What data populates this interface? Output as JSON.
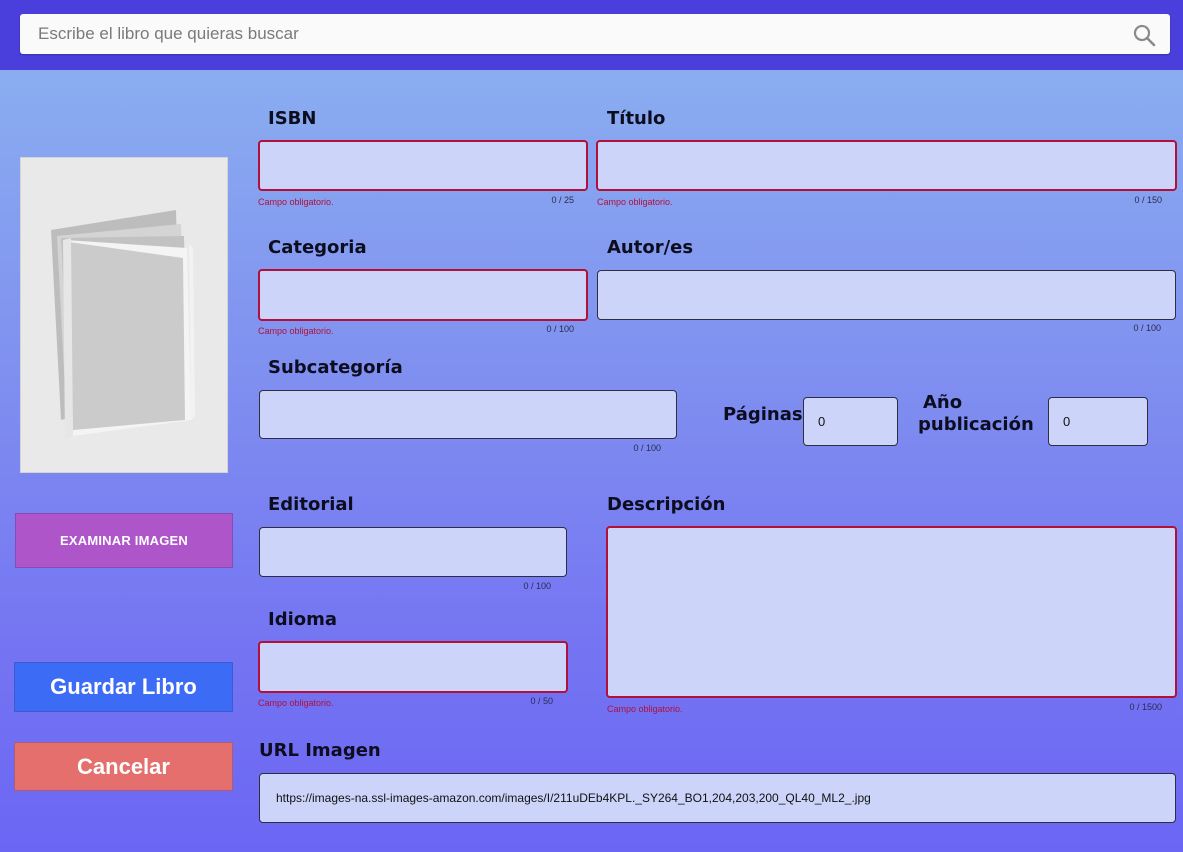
{
  "search": {
    "placeholder": "Escribe el libro que quieras buscar",
    "icon": "search-icon"
  },
  "cover": {
    "icon": "book-placeholder-icon"
  },
  "buttons": {
    "examine": "EXAMINAR IMAGEN",
    "save": "Guardar Libro",
    "cancel": "Cancelar"
  },
  "colors": {
    "topbar": "#4a3fdc",
    "examine_button": "#ad55c9",
    "save_button": "#3c6cf6",
    "cancel_button": "#e46f6d",
    "field_background": "#cdd4fa",
    "error": "#b0103a"
  },
  "form": {
    "isbn": {
      "label": "ISBN",
      "value": "",
      "error": "Campo obligatorio.",
      "counter": "0 / 25"
    },
    "title": {
      "label": "Título",
      "value": "",
      "error": "Campo obligatorio.",
      "counter": "0 / 150"
    },
    "category": {
      "label": "Categoria",
      "value": "",
      "error": "Campo obligatorio.",
      "counter": "0 / 100"
    },
    "authors": {
      "label": "Autor/es",
      "value": "",
      "counter": "0 / 100"
    },
    "subcategory": {
      "label": "Subcategoría",
      "value": "",
      "counter": "0 / 100"
    },
    "pages": {
      "label": "Páginas",
      "value": "0"
    },
    "year": {
      "label_line1": "Año",
      "label_line2": "publicación",
      "value": "0"
    },
    "publisher": {
      "label": "Editorial",
      "value": "",
      "counter": "0 / 100"
    },
    "description": {
      "label": "Descripción",
      "value": "",
      "error": "Campo obligatorio.",
      "counter": "0 / 1500"
    },
    "language": {
      "label": "Idioma",
      "value": "",
      "error": "Campo obligatorio.",
      "counter": "0 / 50"
    },
    "image_url": {
      "label": "URL Imagen",
      "value": "https://images-na.ssl-images-amazon.com/images/I/211uDEb4KPL._SY264_BO1,204,203,200_QL40_ML2_.jpg"
    }
  }
}
